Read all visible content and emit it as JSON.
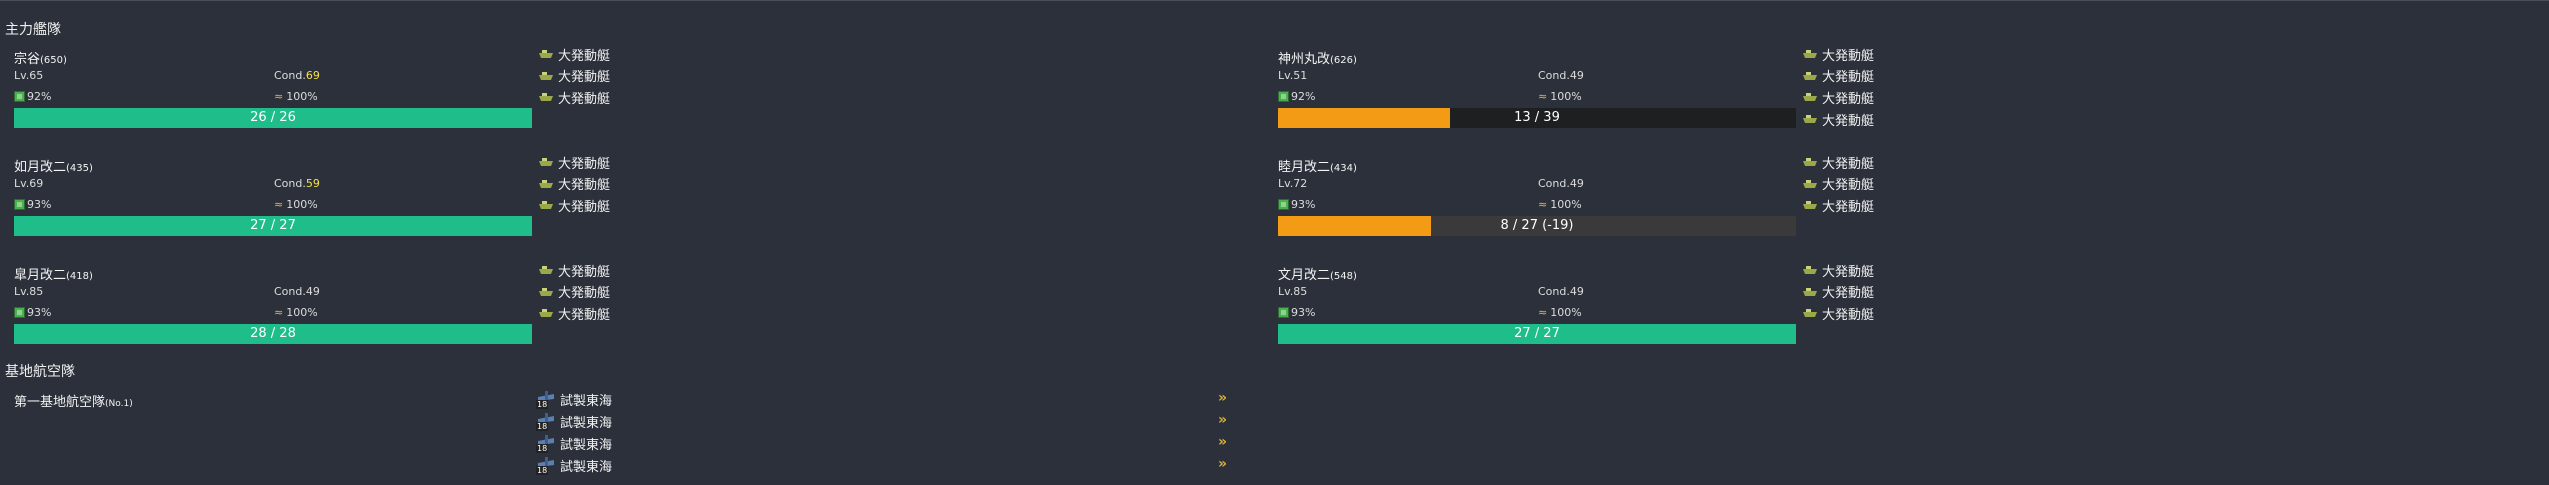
{
  "sections": {
    "main_fleet": "主力艦隊",
    "base_air_corps": "基地航空隊"
  },
  "fleet": [
    {
      "name": "宗谷",
      "id": "(650)",
      "lv": "Lv.65",
      "cond_label": "Cond.",
      "cond": "69",
      "fuel": "92%",
      "ammo": "100%",
      "hp": "26 / 26",
      "hp_ratio": 1.0,
      "hp_color": "#1fbd8a",
      "equips": [
        "大発動艇",
        "大発動艇",
        "大発動艇"
      ]
    },
    {
      "name": "如月改二",
      "id": "(435)",
      "lv": "Lv.69",
      "cond_label": "Cond.",
      "cond": "59",
      "fuel": "93%",
      "ammo": "100%",
      "hp": "27 / 27",
      "hp_ratio": 1.0,
      "hp_color": "#1fbd8a",
      "equips": [
        "大発動艇",
        "大発動艇",
        "大発動艇"
      ]
    },
    {
      "name": "皐月改二",
      "id": "(418)",
      "lv": "Lv.85",
      "cond_label": "Cond.",
      "cond": "49",
      "fuel": "93%",
      "ammo": "100%",
      "hp": "28 / 28",
      "hp_ratio": 1.0,
      "hp_color": "#1fbd8a",
      "equips": [
        "大発動艇",
        "大発動艇",
        "大発動艇"
      ]
    },
    {
      "name": "神州丸改",
      "id": "(626)",
      "lv": "Lv.51",
      "cond_label": "Cond.",
      "cond": "49",
      "fuel": "92%",
      "ammo": "100%",
      "hp": "13 / 39",
      "hp_ratio": 0.333,
      "hp_color": "#f49b16",
      "equips": [
        "大発動艇",
        "大発動艇",
        "大発動艇",
        "大発動艇"
      ]
    },
    {
      "name": "睦月改二",
      "id": "(434)",
      "lv": "Lv.72",
      "cond_label": "Cond.",
      "cond": "49",
      "fuel": "93%",
      "ammo": "100%",
      "hp": "8 / 27 (-19)",
      "hp_ratio": 0.296,
      "hp_color": "#f49b16",
      "equips": [
        "大発動艇",
        "大発動艇",
        "大発動艇"
      ]
    },
    {
      "name": "文月改二",
      "id": "(548)",
      "lv": "Lv.85",
      "cond_label": "Cond.",
      "cond": "49",
      "fuel": "93%",
      "ammo": "100%",
      "hp": "27 / 27",
      "hp_ratio": 1.0,
      "hp_color": "#1fbd8a",
      "equips": [
        "大発動艇",
        "大発動艇",
        "大発動艇"
      ]
    }
  ],
  "base": {
    "name": "第一基地航空隊",
    "sub": "(No.1)",
    "planes": [
      {
        "count": "18",
        "name": "試製東海"
      },
      {
        "count": "18",
        "name": "試製東海"
      },
      {
        "count": "18",
        "name": "試製東海"
      },
      {
        "count": "18",
        "name": "試製東海"
      }
    ]
  },
  "colors": {
    "bg": "#2b303a",
    "hp_full": "#1fbd8a",
    "hp_damaged": "#f49b16",
    "sparkle_cond": "#f5e04a"
  }
}
